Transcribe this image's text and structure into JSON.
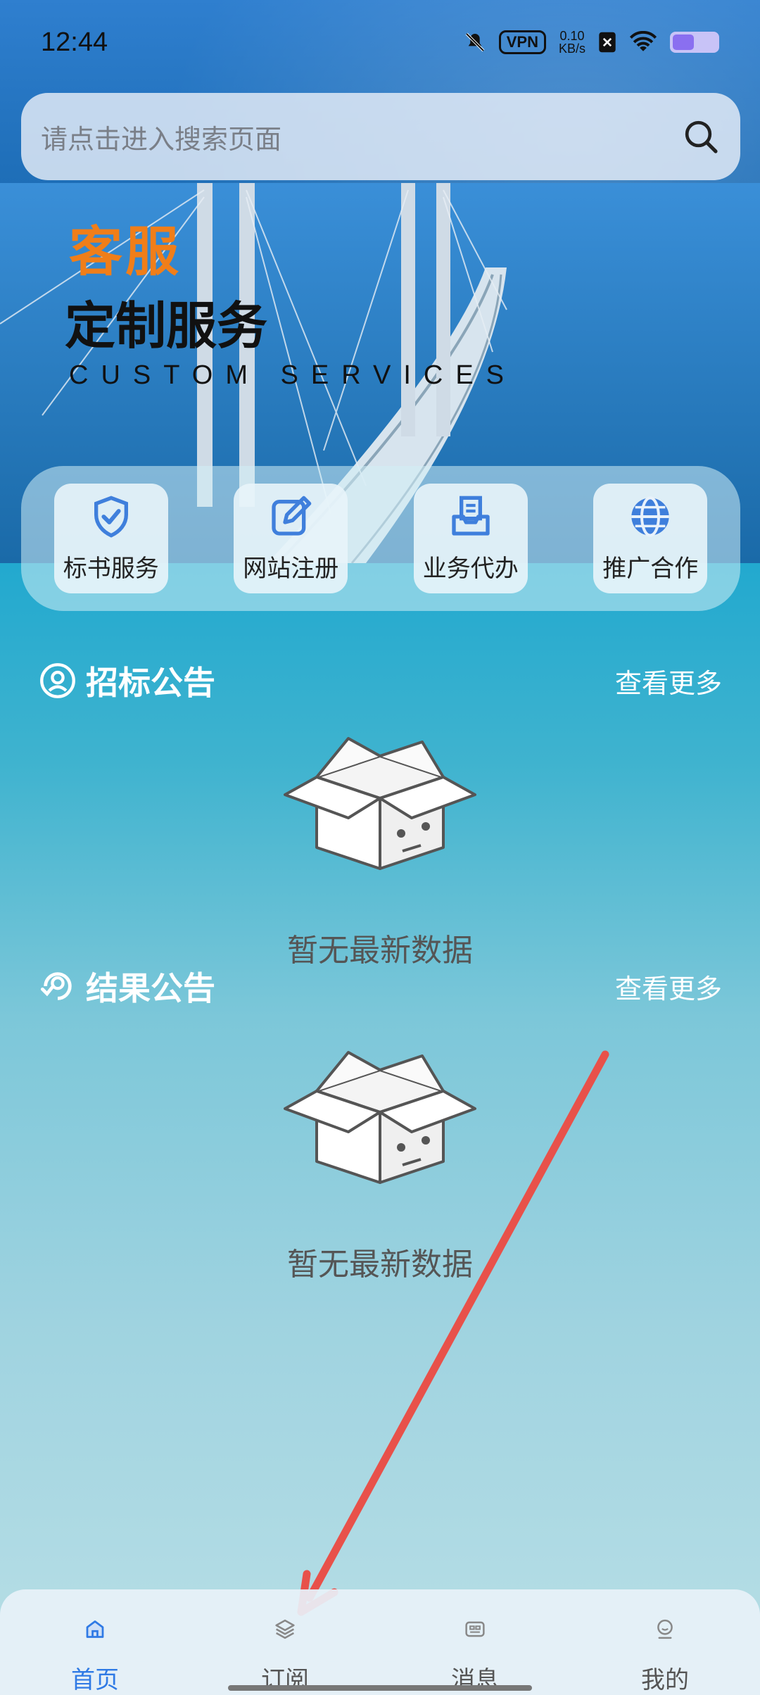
{
  "status_bar": {
    "time": "12:44",
    "vpn": "VPN",
    "speed_value": "0.10",
    "speed_unit": "KB/s"
  },
  "search": {
    "placeholder": "请点击进入搜索页面"
  },
  "banner": {
    "title_orange": "客服",
    "title_black": "定制服务",
    "subtitle": "CUSTOM SERVICES"
  },
  "quick_actions": [
    {
      "label": "标书服务",
      "icon": "shield-check-icon"
    },
    {
      "label": "网站注册",
      "icon": "edit-icon"
    },
    {
      "label": "业务代办",
      "icon": "document-stack-icon"
    },
    {
      "label": "推广合作",
      "icon": "globe-icon"
    }
  ],
  "sections": [
    {
      "title": "招标公告",
      "more": "查看更多",
      "empty_text": "暂无最新数据",
      "icon": "search-person-icon"
    },
    {
      "title": "结果公告",
      "more": "查看更多",
      "empty_text": "暂无最新数据",
      "icon": "result-icon"
    }
  ],
  "tabs": [
    {
      "label": "首页",
      "icon": "home-icon",
      "active": true
    },
    {
      "label": "订阅",
      "icon": "layers-icon",
      "active": false
    },
    {
      "label": "消息",
      "icon": "message-icon",
      "active": false
    },
    {
      "label": "我的",
      "icon": "profile-icon",
      "active": false
    }
  ],
  "colors": {
    "accent": "#2f7ae5",
    "banner_orange": "#f07e19",
    "annotation_arrow": "#e8514a"
  }
}
